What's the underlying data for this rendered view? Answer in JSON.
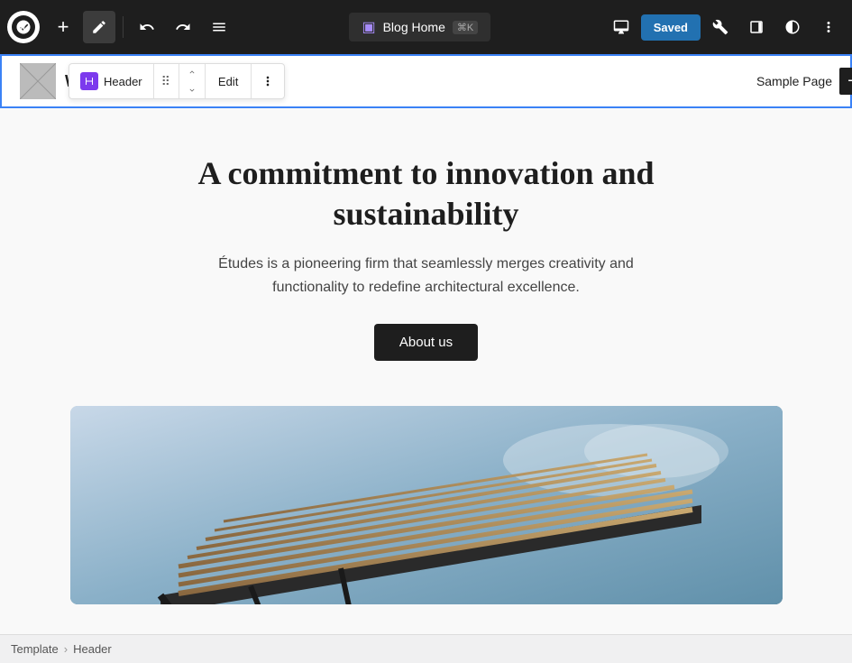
{
  "toolbar": {
    "add_label": "+",
    "pencil_icon": "✏",
    "undo_icon": "←",
    "redo_icon": "→",
    "list_icon": "≡",
    "preview": {
      "icon": "▣",
      "label": "Blog Home",
      "shortcut": "⌘K"
    },
    "device_icons": [
      "□",
      "▣",
      "◑"
    ],
    "saved_label": "Saved",
    "wrench_icon": "🔧",
    "sidebar_icon": "▥",
    "contrast_icon": "◑",
    "more_icon": "⋯"
  },
  "block_toolbar": {
    "block_name": "Header",
    "edit_label": "Edit",
    "more_icon": "⋯",
    "up_icon": "▲",
    "down_icon": "▼"
  },
  "site_header": {
    "logo_text": "WPZOOM",
    "nav_link": "Sample Page"
  },
  "hero": {
    "title": "A commitment to innovation and sustainability",
    "subtitle": "Études is a pioneering firm that seamlessly merges creativity and functionality to redefine architectural excellence.",
    "cta_label": "About us"
  },
  "breadcrumb": {
    "template_label": "Template",
    "separator": "›",
    "header_label": "Header"
  },
  "colors": {
    "accent_blue": "#3b82f6",
    "wp_purple": "#7c3aed",
    "dark": "#1e1e1e",
    "saved_blue": "#2271b1"
  }
}
